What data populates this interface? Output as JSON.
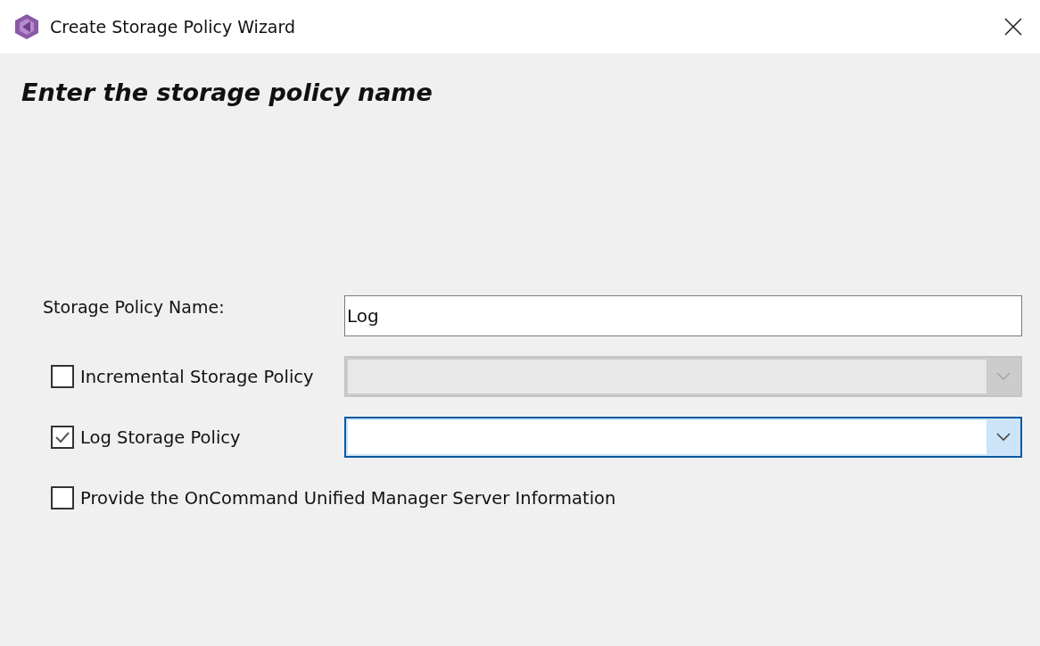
{
  "window": {
    "title": "Create Storage Policy Wizard"
  },
  "heading": "Enter the storage policy name",
  "name_field": {
    "label": "Storage Policy Name:",
    "value": "Log"
  },
  "options": [
    {
      "label": "Incremental Storage Policy",
      "checked": false,
      "kind": "dropdown",
      "disabled": true,
      "focused": false
    },
    {
      "label": "Log Storage Policy",
      "checked": true,
      "kind": "dropdown",
      "disabled": false,
      "focused": true
    },
    {
      "label": "Provide the OnCommand Unified Manager Server Information",
      "checked": false,
      "kind": "plain"
    }
  ]
}
